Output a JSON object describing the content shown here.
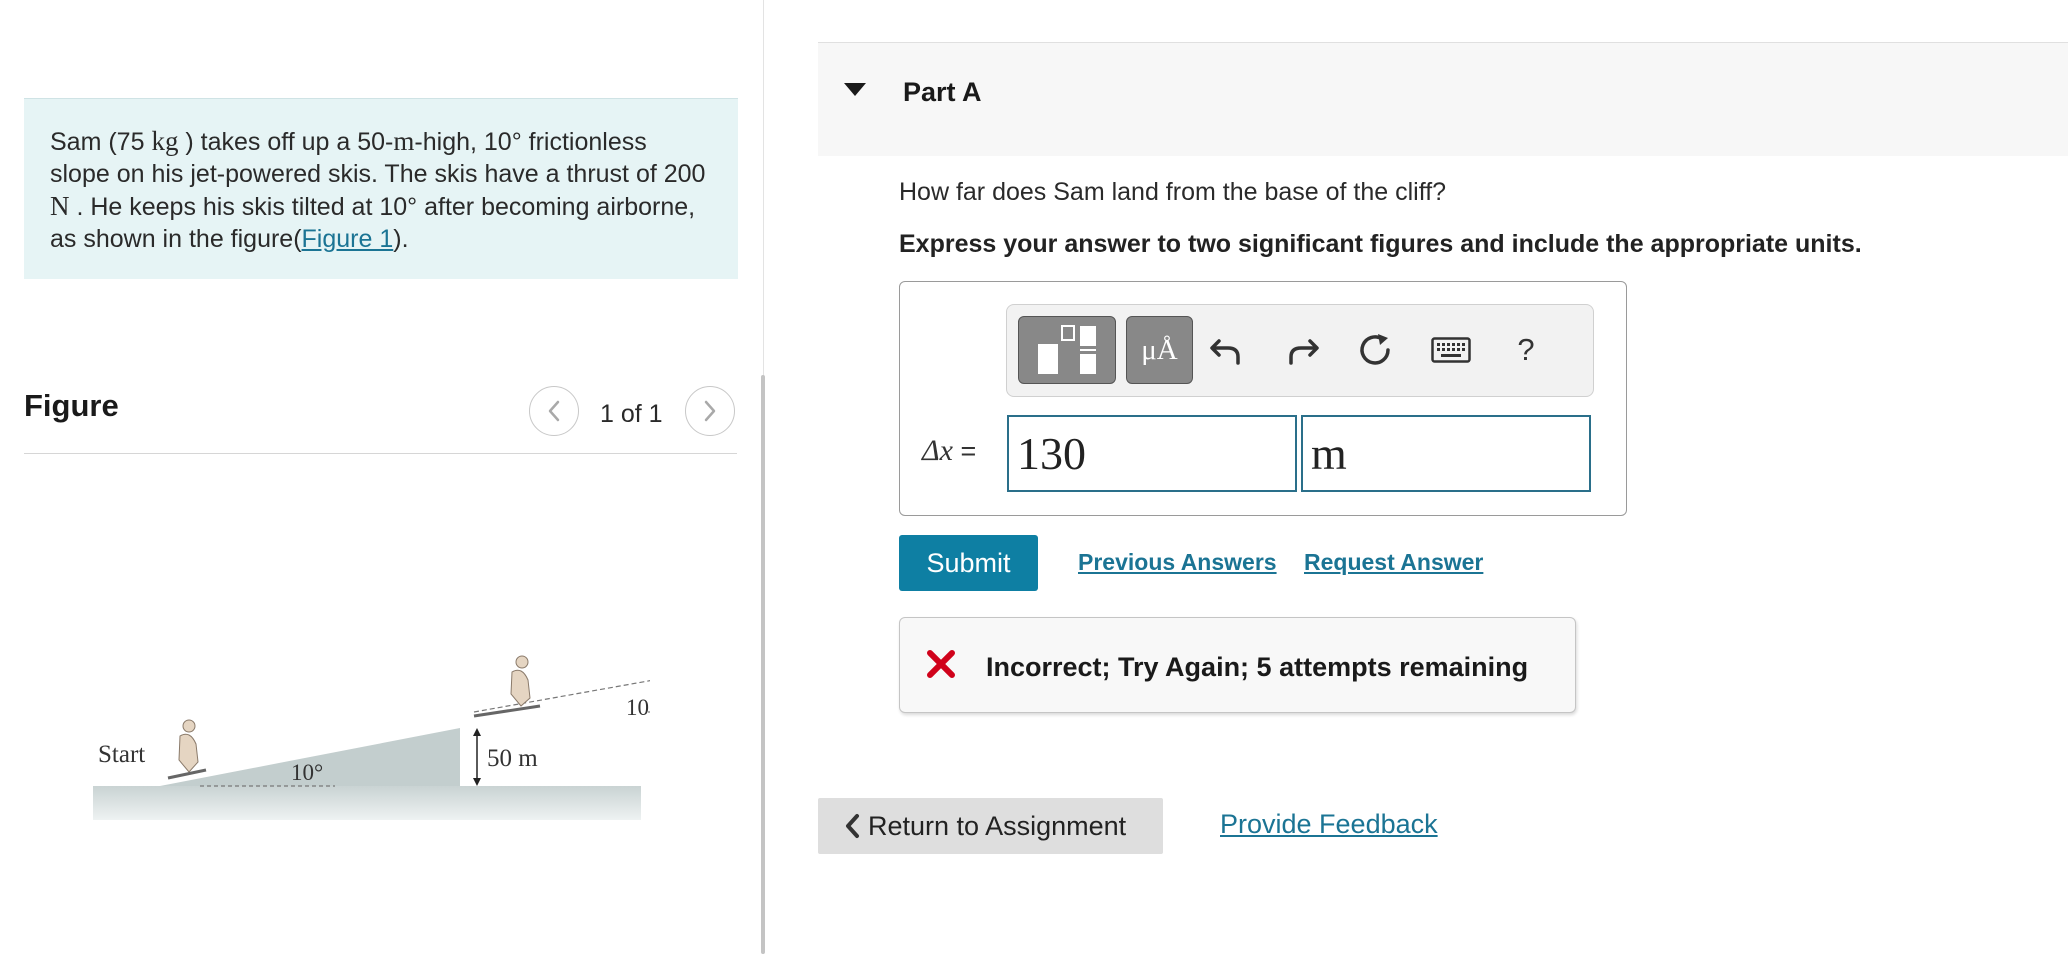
{
  "problem": {
    "seg1": "Sam (75 ",
    "mass_unit": "kg",
    "seg2": " ) takes off up a 50-",
    "height_unit": "m",
    "seg3": "-high, 10° frictionless slope on his jet-powered skis. The skis have a thrust of 200 ",
    "thrust_unit": "N",
    "seg4": " . He keeps his skis tilted at 10° after becoming airborne, as shown in the figure(",
    "figure_link": "Figure 1",
    "seg5": ")."
  },
  "figure": {
    "title": "Figure",
    "page_count": "1 of 1",
    "labels": {
      "start": "Start",
      "slope_angle": "10°",
      "height": "50 m",
      "jet_angle": "10°"
    }
  },
  "part": {
    "title": "Part A"
  },
  "question": {
    "text": "How far does Sam land from the base of the cliff?",
    "instruction": "Express your answer to two significant figures and include the appropriate units."
  },
  "toolbar": {
    "units_label": "μÅ",
    "help_label": "?"
  },
  "answer": {
    "variable_label": "Δx",
    "equals": " =",
    "value": "130",
    "unit": "m"
  },
  "actions": {
    "submit": "Submit",
    "previous_answers": "Previous Answers",
    "request_answer": "Request Answer"
  },
  "feedback": {
    "message": "Incorrect; Try Again; 5 attempts remaining"
  },
  "footer": {
    "return_label": "Return to Assignment",
    "provide_feedback": "Provide Feedback"
  },
  "colors": {
    "accent": "#0e7fa3",
    "link": "#1b7494",
    "error": "#d0021b",
    "problem_bg": "#e6f4f5"
  }
}
